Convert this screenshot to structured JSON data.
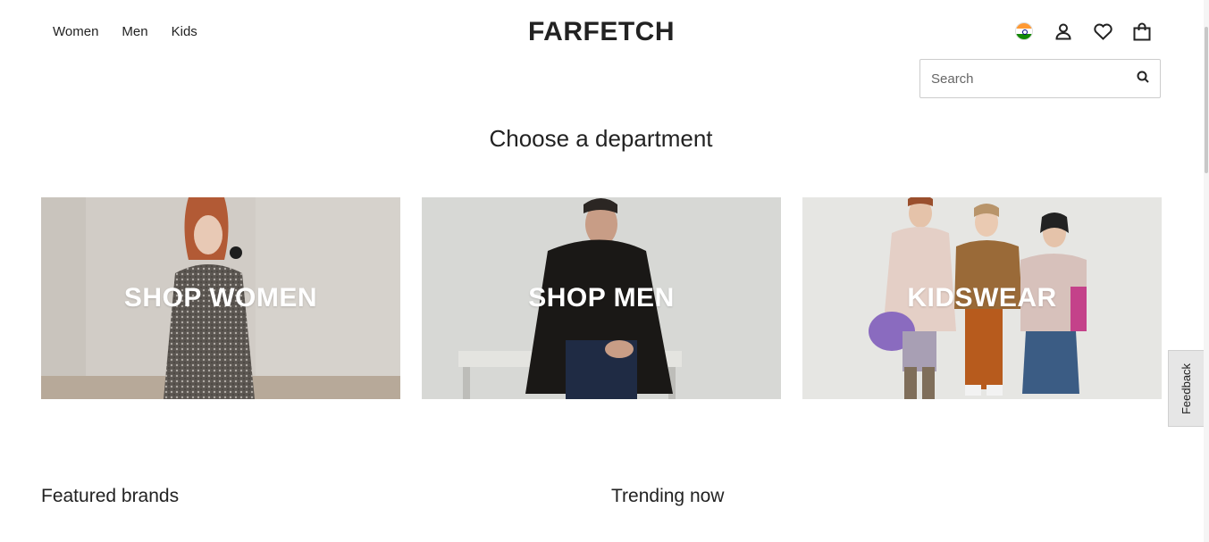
{
  "header": {
    "nav": [
      "Women",
      "Men",
      "Kids"
    ],
    "logo": "FARFETCH",
    "icons": [
      "india-flag-icon",
      "account-icon",
      "wishlist-heart-icon",
      "shopping-bag-icon"
    ]
  },
  "search": {
    "placeholder": "Search",
    "value": ""
  },
  "main": {
    "title": "Choose a department",
    "departments": [
      {
        "label": "SHOP WOMEN"
      },
      {
        "label": "SHOP MEN"
      },
      {
        "label": "KIDSWEAR"
      }
    ]
  },
  "sections": {
    "featured": "Featured brands",
    "trending": "Trending now"
  },
  "feedback": {
    "label": "Feedback"
  },
  "colors": {
    "text": "#222222",
    "background": "#ffffff",
    "border": "#cccccc"
  }
}
